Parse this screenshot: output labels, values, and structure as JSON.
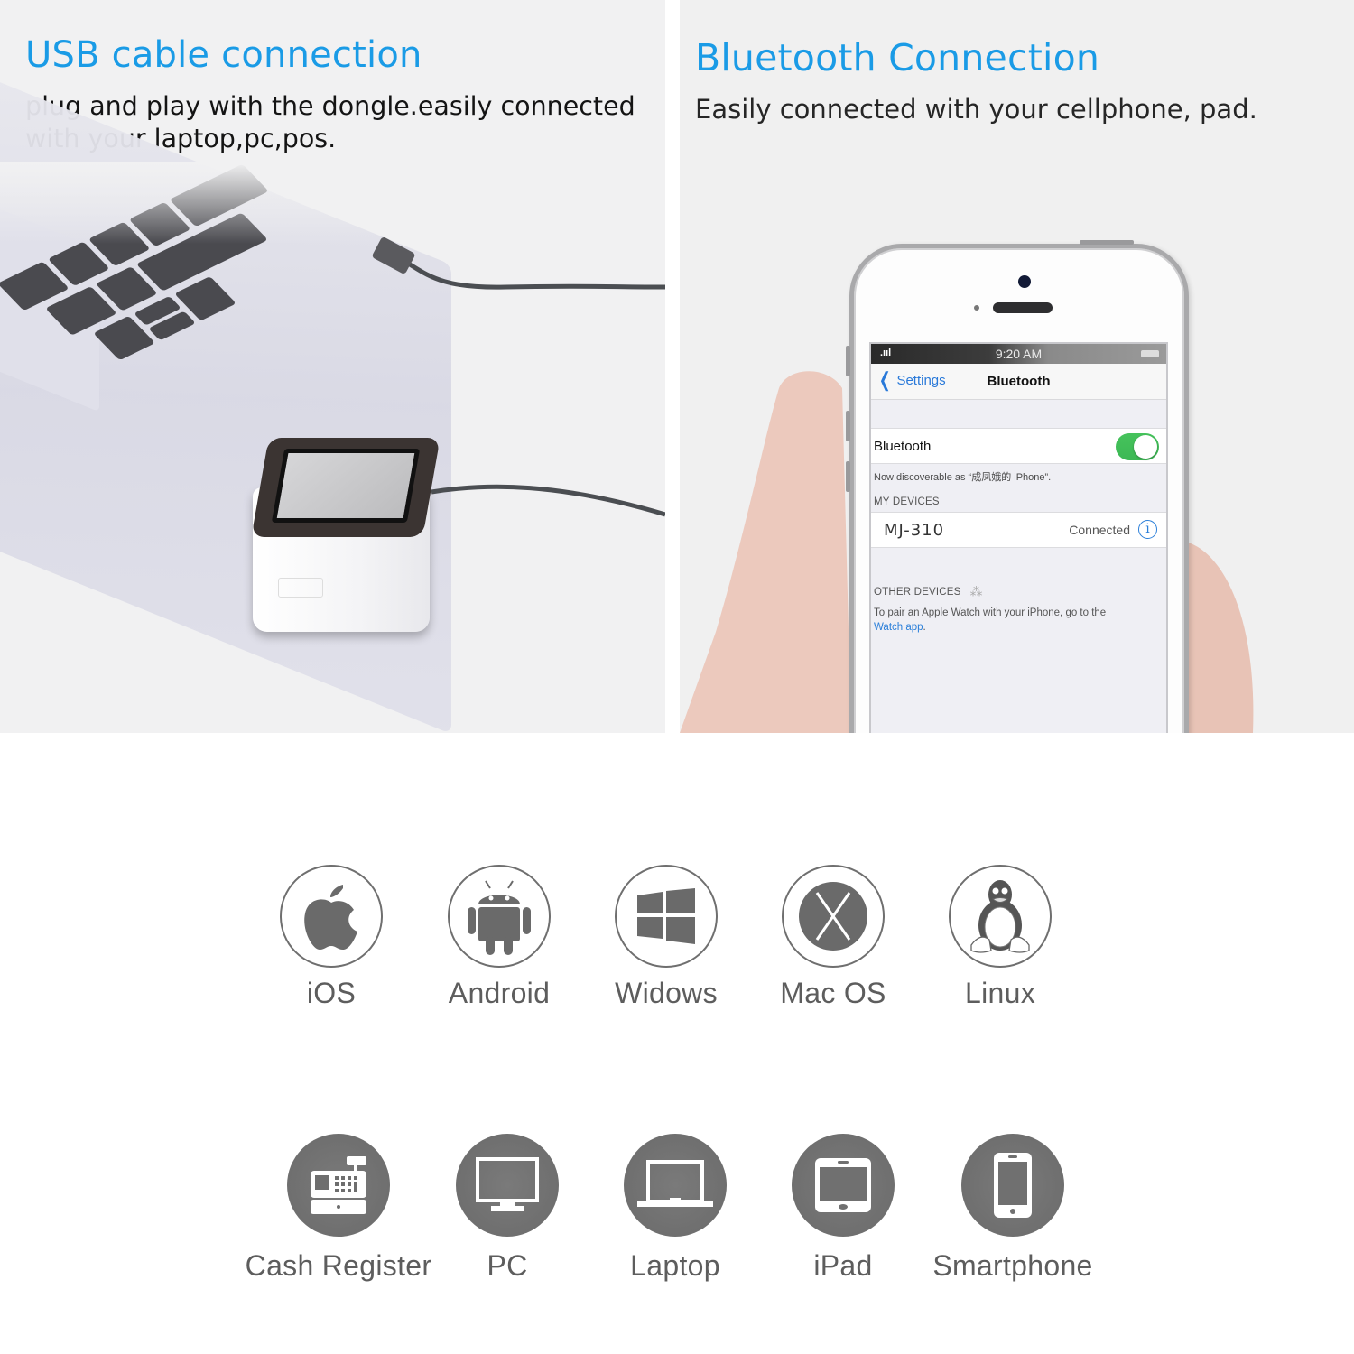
{
  "usb_panel": {
    "title": "USB cable connection",
    "description_line1": "plug and play with the dongle.easily connected",
    "description_line2": "with your laptop,pc,pos."
  },
  "bluetooth_panel": {
    "title": "Bluetooth Connection",
    "description": "Easily connected with your cellphone, pad."
  },
  "phone_screen": {
    "status_time": "9:20 AM",
    "back_label": "Settings",
    "nav_title": "Bluetooth",
    "bluetooth_row_label": "Bluetooth",
    "bluetooth_enabled": true,
    "discoverable_text": "Now discoverable as “成凤娥的 iPhone”.",
    "my_devices_header": "MY DEVICES",
    "devices": [
      {
        "name": "MJ-310",
        "status": "Connected"
      }
    ],
    "other_devices_header": "OTHER DEVICES",
    "pair_text": "To pair an Apple Watch with your iPhone, go to the",
    "pair_link": "Watch app",
    "pair_text_end": "."
  },
  "os_support": [
    {
      "label": "iOS",
      "icon": "apple-icon"
    },
    {
      "label": "Android",
      "icon": "android-icon"
    },
    {
      "label": "Widows",
      "icon": "windows-icon"
    },
    {
      "label": "Mac OS",
      "icon": "macos-x-icon"
    },
    {
      "label": "Linux",
      "icon": "linux-tux-icon"
    }
  ],
  "device_support": [
    {
      "label": "Cash Register",
      "icon": "cash-register-icon"
    },
    {
      "label": "PC",
      "icon": "monitor-icon"
    },
    {
      "label": "Laptop",
      "icon": "laptop-icon"
    },
    {
      "label": "iPad",
      "icon": "tablet-icon"
    },
    {
      "label": "Smartphone",
      "icon": "smartphone-icon"
    }
  ],
  "colors": {
    "title_blue": "#1a9be6",
    "icon_gray": "#6f6f6f",
    "toggle_green": "#46c35c",
    "ios_link_blue": "#2b7fd9"
  }
}
